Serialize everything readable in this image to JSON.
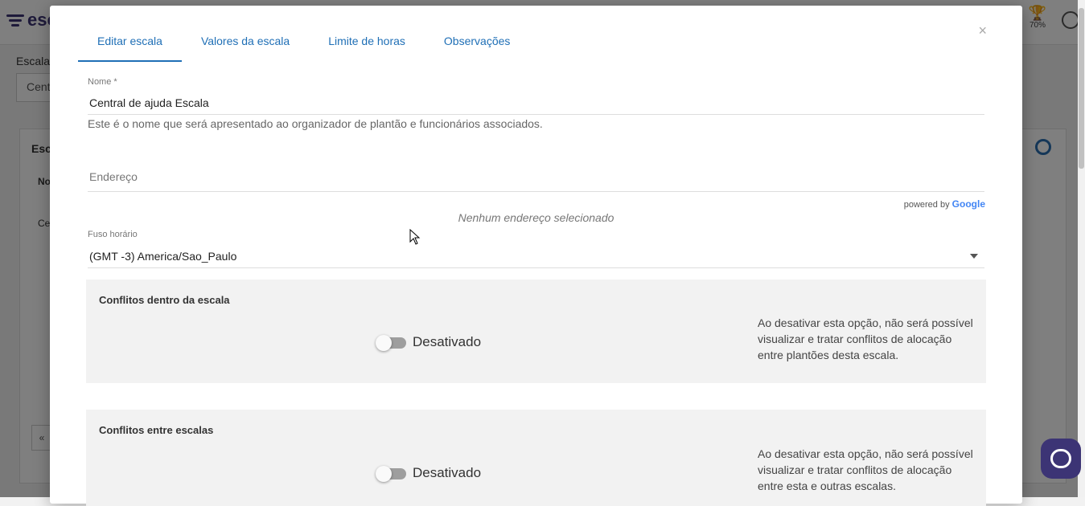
{
  "app": {
    "brand": "esc",
    "trophy_percent": "70%",
    "bg_title": "Escalas",
    "bg_select_value": "Cent",
    "bg_card_title": "Esca",
    "bg_column": "No",
    "bg_row": "Ce",
    "bg_pager": "«"
  },
  "modal": {
    "close_label": "×",
    "tabs": [
      {
        "label": "Editar escala",
        "active": true
      },
      {
        "label": "Valores da escala",
        "active": false
      },
      {
        "label": "Limite de horas",
        "active": false
      },
      {
        "label": "Observações",
        "active": false
      }
    ],
    "name": {
      "label": "Nome *",
      "value": "Central de ajuda Escala",
      "hint": "Este é o nome que será apresentado ao organizador de plantão e funcionários associados."
    },
    "address": {
      "placeholder": "Endereço",
      "powered_by": "powered by",
      "google": "Google",
      "empty_message": "Nenhum endereço selecionado"
    },
    "timezone": {
      "label": "Fuso horário",
      "value": "(GMT -3) America/Sao_Paulo"
    },
    "panels": [
      {
        "title": "Conflitos dentro da escala",
        "toggle_label": "Desativado",
        "description": "Ao desativar esta opção, não será possível visualizar e tratar conflitos de alocação entre plantões desta escala."
      },
      {
        "title": "Conflitos entre escalas",
        "toggle_label": "Desativado",
        "description": "Ao desativar esta opção, não será possível visualizar e tratar conflitos de alocação entre esta e outras escalas."
      }
    ]
  },
  "colors": {
    "accent": "#1f6fb6",
    "brand": "#3c3475",
    "panel_bg": "#f2f2f2"
  }
}
